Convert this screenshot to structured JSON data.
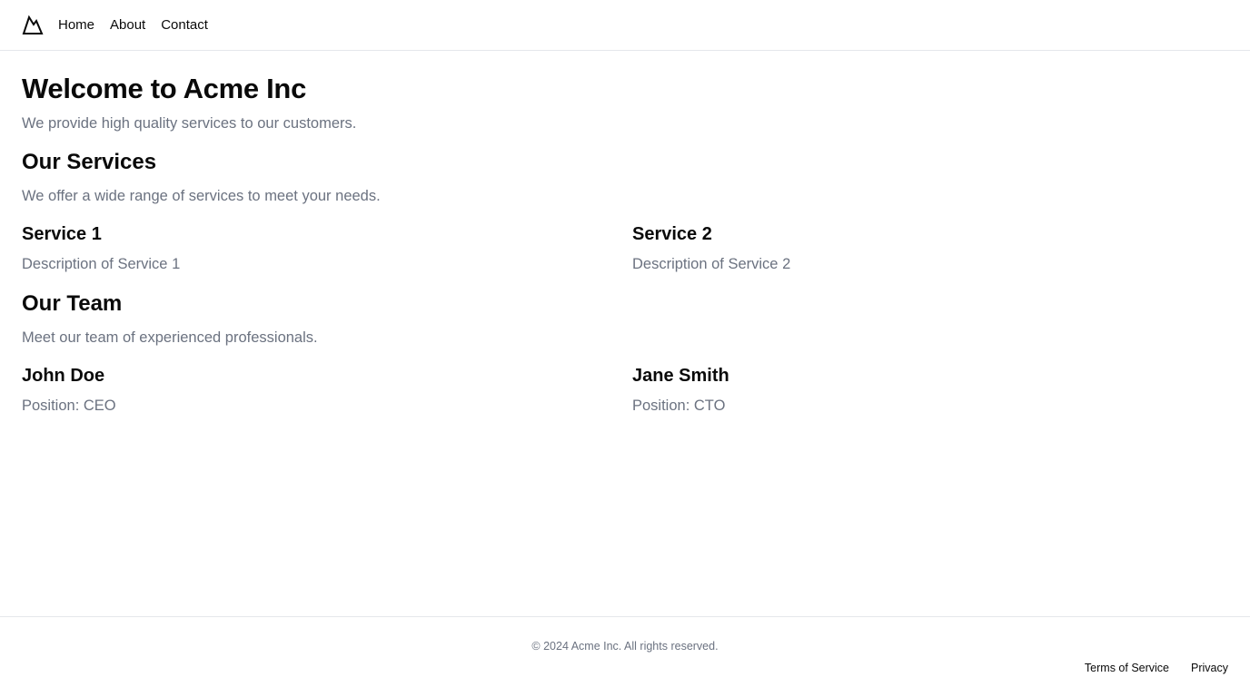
{
  "header": {
    "logo_icon": "mountain-icon",
    "nav": [
      {
        "label": "Home"
      },
      {
        "label": "About"
      },
      {
        "label": "Contact"
      }
    ]
  },
  "hero": {
    "title": "Welcome to Acme Inc",
    "subtitle": "We provide high quality services to our customers."
  },
  "services": {
    "title": "Our Services",
    "subtitle": "We offer a wide range of services to meet your needs.",
    "items": [
      {
        "name": "Service 1",
        "description": "Description of Service 1"
      },
      {
        "name": "Service 2",
        "description": "Description of Service 2"
      }
    ]
  },
  "team": {
    "title": "Our Team",
    "subtitle": "Meet our team of experienced professionals.",
    "members": [
      {
        "name": "John Doe",
        "position": "Position: CEO"
      },
      {
        "name": "Jane Smith",
        "position": "Position: CTO"
      }
    ]
  },
  "footer": {
    "copyright": "© 2024 Acme Inc. All rights reserved.",
    "links": [
      {
        "label": "Terms of Service"
      },
      {
        "label": "Privacy"
      }
    ]
  },
  "colors": {
    "text": "#0a0a0a",
    "muted": "#6b7280",
    "border": "#e5e7eb"
  }
}
